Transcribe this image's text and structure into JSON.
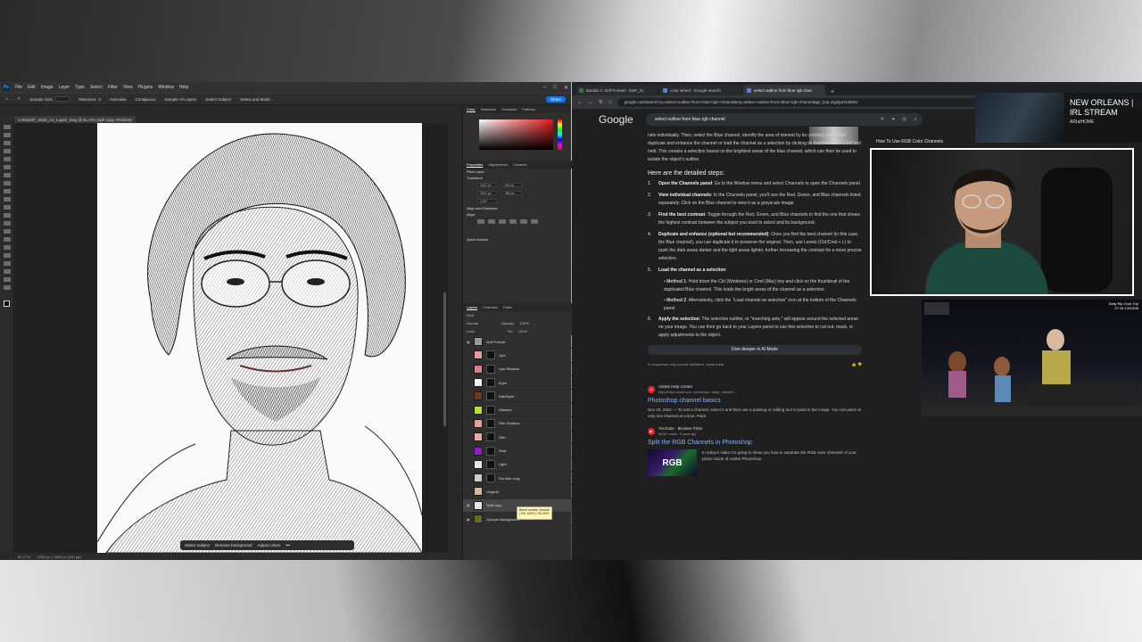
{
  "photoshop": {
    "logo": "Ps",
    "menu": [
      "File",
      "Edit",
      "Image",
      "Layer",
      "Type",
      "Select",
      "Filter",
      "View",
      "Plugins",
      "Window",
      "Help"
    ],
    "options": {
      "sample_size_label": "Sample Size:",
      "sample_size_value": "Point Sample",
      "tolerance_label": "Tolerance:",
      "tolerance_value": "0",
      "anti_alias": "Anti-alias",
      "contiguous": "Contiguous",
      "sample_all_layers": "Sample All Layers",
      "select_subject": "Select Subject",
      "select_and_mask": "Select and Mask..."
    },
    "share_label": "Share",
    "document_tab": "CAM1037_2020_A1_Lopez_Dog @ 81.2% (Split copy, RGB/16)",
    "context_bar": [
      "Select subject",
      "Remove background",
      "Adjust colors"
    ],
    "status": {
      "zoom": "81.17%",
      "doc_size": "1200 px × 1600 px (300 ppi)"
    },
    "panel_tabs_top": [
      "Color",
      "Swatches",
      "Gradients",
      "Patterns"
    ],
    "properties": {
      "tabs": [
        "Properties",
        "Adjustments",
        "Libraries"
      ],
      "layer_type": "Pixel Layer",
      "transform_title": "Transform",
      "w": "2187 px",
      "x": "604 px",
      "h": "2947 px",
      "y": "380 px",
      "angle": "0.00°",
      "align_title": "Align and Distribute",
      "align_sub": "Align:",
      "quick_actions": "Quick Actions"
    },
    "layers_panel": {
      "tabs": [
        "Layers",
        "Channels",
        "Paths"
      ],
      "kind": "Kind",
      "blend": "Normal",
      "opacity_label": "Opacity:",
      "opacity": "100%",
      "lock_label": "Lock:",
      "fill_label": "Fill:",
      "fill": "100%",
      "layers": [
        {
          "name": "Self Portrait",
          "color": "#9a9a9a"
        },
        {
          "name": "Lips",
          "color": "#e49aa0"
        },
        {
          "name": "Lips Shadow",
          "color": "#d97f88"
        },
        {
          "name": "Eyes",
          "color": "#f2f2f2"
        },
        {
          "name": "Hair/Eyes",
          "color": "#6b3d1e"
        },
        {
          "name": "Glasses",
          "color": "#b7e13a"
        },
        {
          "name": "Skin Shadow",
          "color": "#e6a09a"
        },
        {
          "name": "Skin",
          "color": "#e8aba6"
        },
        {
          "name": "Shirt",
          "color": "#8c1fc4"
        },
        {
          "name": "Light",
          "color": "#e8e8e8"
        },
        {
          "name": "Far side copy",
          "color": "#cfcfcf"
        },
        {
          "name": "Original",
          "color": "#d4b89a"
        },
        {
          "name": "Split copy",
          "color": "#e6e6e6"
        },
        {
          "name": "Opaque Background",
          "color": "#6b6b24"
        }
      ],
      "tooltip": "Blend modes: Normal | Fill: 100% | Fill: 99%"
    }
  },
  "browser": {
    "tabs": [
      {
        "title": "Bandia 3: Self Portrait - DSP_Sc",
        "fav": "#1a7f37"
      },
      {
        "title": "color wheel - Google Search",
        "fav": "#4285f4"
      },
      {
        "title": "select outline from blue rgb chan",
        "fav": "#4285f4"
      }
    ],
    "url": "google.com/search?q=select+outline+from+blue+rgb+channel&oq=select+outline+from+blue+rgb+channel&gs_lcrp=EgZjaHJvbWU",
    "google": {
      "logo": "Google",
      "query": "select outline from blue rgb channel",
      "intro": "nels individually. Then, select the Blue channel, identify the area of interest by its contrast, and either duplicate and enhance the channel or load the channel as a selection by clicking its thumbnail with Ctrl/Cmd held. This creates a selection based on the brightest areas of the blue channel, which can then be used to isolate the object's outline.",
      "steps_heading": "Here are the detailed steps:",
      "steps": [
        {
          "num": "1.",
          "title": "Open the Channels panel",
          "text": ": Go to the Window menu and select Channels to open the Channels panel."
        },
        {
          "num": "2.",
          "title": "View individual channels",
          "text": ": In the Channels panel, you'll see the Red, Green, and Blue channels listed separately. Click on the Blue channel to view it as a grayscale image."
        },
        {
          "num": "3.",
          "title": "Find the best contrast",
          "text": ": Toggle through the Red, Green, and Blue channels to find the one that shows the highest contrast between the subject you want to select and its background."
        },
        {
          "num": "4.",
          "title": "Duplicate and enhance (optional but recommended)",
          "text": ": Once you find the best channel (in this case, the Blue channel), you can duplicate it to preserve the original. Then, use Levels (Ctrl/Cmd + L) to push the dark areas darker and the light areas lighter, further increasing the contrast for a more precise selection."
        },
        {
          "num": "5.",
          "title": "Load the channel as a selection",
          "text": ":"
        },
        {
          "num": "6.",
          "title": "Apply the selection",
          "text": ": The selection outline, or \"marching ants,\" will appear around the selected areas on your image. You can then go back to your Layers panel to use this selection to cut out, mask, or apply adjustments to the object."
        }
      ],
      "methods": [
        {
          "title": "Method 1",
          "text": ": Hold down the Ctrl (Windows) or Cmd (Mac) key and click on the thumbnail of the duplicated Blue channel. This loads the bright areas of the channel as a selection."
        },
        {
          "title": "Method 2",
          "text": ": Alternatively, click the \"Load channel as selection\" icon at the bottom of the Channels panel."
        }
      ],
      "dive_label": "Dive deeper in AI Mode",
      "disclaimer": "AI responses may include mistakes.",
      "learn_more": "Learn more",
      "video_label": "How To Use RGB Color Channels",
      "results": [
        {
          "site": "Adobe Help Center",
          "url": "https://helpx.adobe.com › photoshop › using › channel-...",
          "title": "Photoshop channel basics",
          "date": "Nov 10, 2022",
          "snippet": " — To edit a channel, select it and then use a painting or editing tool to paint in the image. You can paint on only one channel at a time. Paint"
        },
        {
          "site": "YouTube · Brooker Films",
          "url": "88.6K+ views · 8 years ago",
          "title": "Split the RGB Channels in Photoshop",
          "date": "",
          "snippet": "In today's video I'm going to show you how to separate the RGB color channels of your photo inside of Adobe Photoshop."
        }
      ],
      "yt_thumb_text": "RGB"
    }
  },
  "stream": {
    "title_line1": "NEW ORLEANS |",
    "title_line2": "IRL STREAM",
    "channel": "ARIatHOME",
    "irl_tag": "Daily Rip Cruit Trip",
    "irl_time": "07:16 13/23/08"
  }
}
